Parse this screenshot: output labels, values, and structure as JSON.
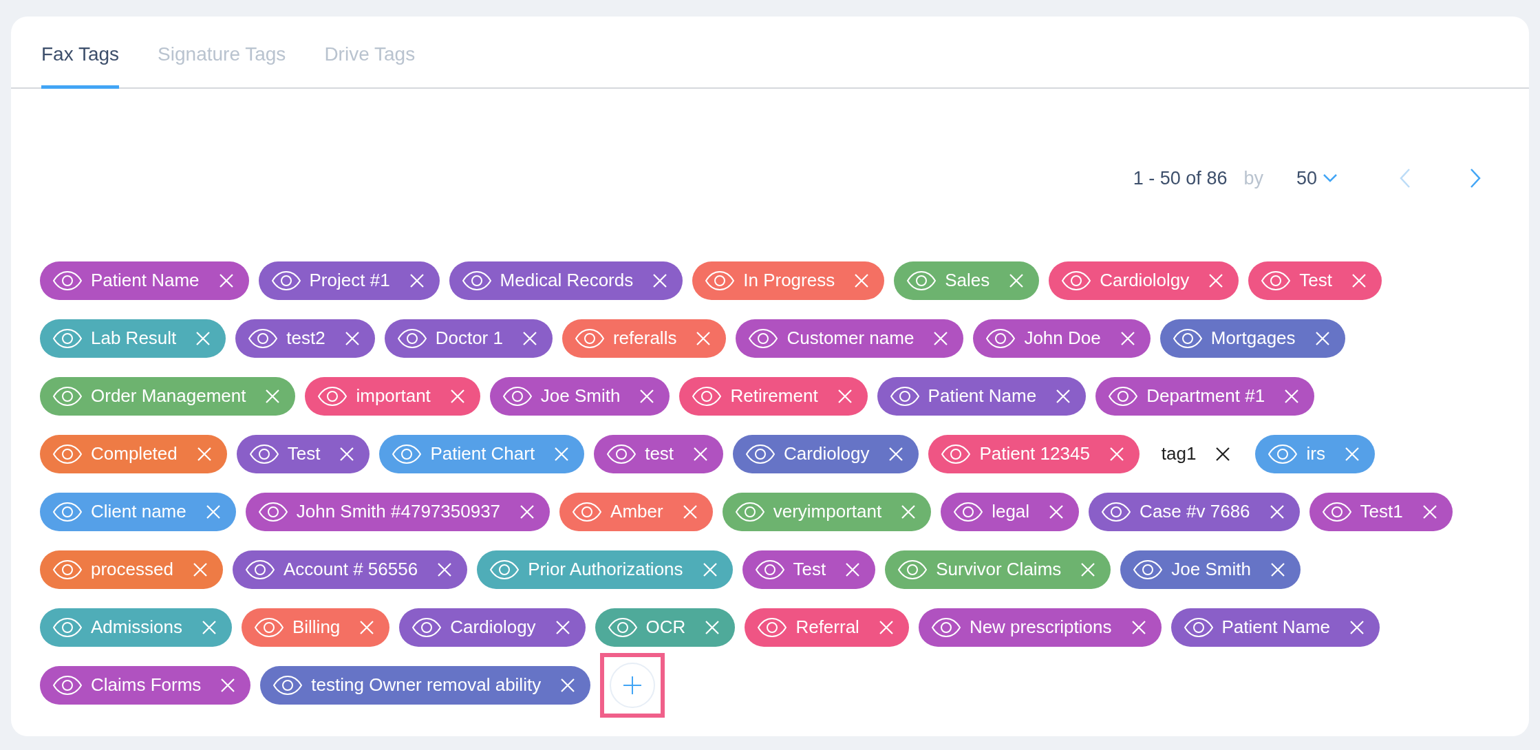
{
  "tabs": [
    {
      "label": "Fax Tags",
      "selected": true
    },
    {
      "label": "Signature Tags",
      "selected": false
    },
    {
      "label": "Drive Tags",
      "selected": false
    }
  ],
  "pagination": {
    "range": "1 - 50 of 86",
    "by": "by",
    "page_size": "50",
    "prev_disabled": true,
    "next_disabled": false
  },
  "tag_rows": [
    [
      {
        "kind": "colored",
        "label": "Patient Name",
        "color": "#b052c0"
      },
      {
        "kind": "colored",
        "label": "Project #1",
        "color": "#8a5fc8"
      },
      {
        "kind": "colored",
        "label": "Medical Records",
        "color": "#8a5fc8"
      },
      {
        "kind": "colored",
        "label": "In Progress",
        "color": "#f47063"
      },
      {
        "kind": "colored",
        "label": "Sales",
        "color": "#6db36f"
      },
      {
        "kind": "colored",
        "label": "Cardiololgy",
        "color": "#ef5584"
      },
      {
        "kind": "colored",
        "label": "Test",
        "color": "#ef5584"
      }
    ],
    [
      {
        "kind": "colored",
        "label": "Lab Result",
        "color": "#4fadb8"
      },
      {
        "kind": "colored",
        "label": "test2",
        "color": "#8a5fc8"
      },
      {
        "kind": "colored",
        "label": "Doctor 1",
        "color": "#8a5fc8"
      },
      {
        "kind": "colored",
        "label": "referalls",
        "color": "#f47063"
      },
      {
        "kind": "colored",
        "label": "Customer name",
        "color": "#b052c0"
      },
      {
        "kind": "colored",
        "label": "John Doe",
        "color": "#b052c0"
      },
      {
        "kind": "colored",
        "label": "Mortgages",
        "color": "#6674c6"
      }
    ],
    [
      {
        "kind": "colored",
        "label": "Order Management",
        "color": "#6db36f"
      },
      {
        "kind": "colored",
        "label": "important",
        "color": "#ef5584"
      },
      {
        "kind": "colored",
        "label": "Joe Smith",
        "color": "#b052c0"
      },
      {
        "kind": "colored",
        "label": "Retirement",
        "color": "#ef5584"
      },
      {
        "kind": "colored",
        "label": "Patient Name",
        "color": "#8a5fc8"
      },
      {
        "kind": "colored",
        "label": "Department #1",
        "color": "#b052c0"
      }
    ],
    [
      {
        "kind": "colored",
        "label": "Completed",
        "color": "#ee7b45"
      },
      {
        "kind": "colored",
        "label": "Test",
        "color": "#8a5fc8"
      },
      {
        "kind": "colored",
        "label": "Patient Chart",
        "color": "#55a0e8"
      },
      {
        "kind": "colored",
        "label": "test",
        "color": "#b052c0"
      },
      {
        "kind": "colored",
        "label": "Cardiology",
        "color": "#6674c6"
      },
      {
        "kind": "colored",
        "label": "Patient 12345",
        "color": "#ef5584"
      },
      {
        "kind": "plain",
        "label": "tag1"
      },
      {
        "kind": "colored",
        "label": "irs",
        "color": "#55a0e8"
      }
    ],
    [
      {
        "kind": "colored",
        "label": "Client name",
        "color": "#55a0e8"
      },
      {
        "kind": "colored",
        "label": "John Smith #4797350937",
        "color": "#b052c0"
      },
      {
        "kind": "colored",
        "label": "Amber",
        "color": "#f47063"
      },
      {
        "kind": "colored",
        "label": "veryimportant",
        "color": "#6db36f"
      },
      {
        "kind": "colored",
        "label": "legal",
        "color": "#b052c0"
      },
      {
        "kind": "colored",
        "label": "Case #v 7686",
        "color": "#8a5fc8"
      },
      {
        "kind": "colored",
        "label": "Test1",
        "color": "#b052c0"
      }
    ],
    [
      {
        "kind": "colored",
        "label": "processed",
        "color": "#ee7b45"
      },
      {
        "kind": "colored",
        "label": "Account # 56556",
        "color": "#8a5fc8"
      },
      {
        "kind": "colored",
        "label": "Prior Authorizations",
        "color": "#4fadb8"
      },
      {
        "kind": "colored",
        "label": "Test",
        "color": "#b052c0"
      },
      {
        "kind": "colored",
        "label": "Survivor Claims",
        "color": "#6db36f"
      },
      {
        "kind": "colored",
        "label": "Joe Smith",
        "color": "#6674c6"
      }
    ],
    [
      {
        "kind": "colored",
        "label": "Admissions",
        "color": "#4fadb8"
      },
      {
        "kind": "colored",
        "label": "Billing",
        "color": "#f47063"
      },
      {
        "kind": "colored",
        "label": "Cardiology",
        "color": "#8a5fc8"
      },
      {
        "kind": "colored",
        "label": "OCR",
        "color": "#4faa9a"
      },
      {
        "kind": "colored",
        "label": "Referral",
        "color": "#ef5584"
      },
      {
        "kind": "colored",
        "label": "New prescriptions",
        "color": "#b052c0"
      },
      {
        "kind": "colored",
        "label": "Patient Name",
        "color": "#8a5fc8"
      }
    ],
    [
      {
        "kind": "colored",
        "label": "Claims Forms",
        "color": "#b052c0"
      },
      {
        "kind": "colored",
        "label": "testing Owner removal ability",
        "color": "#6674c6"
      },
      {
        "kind": "add"
      }
    ]
  ]
}
